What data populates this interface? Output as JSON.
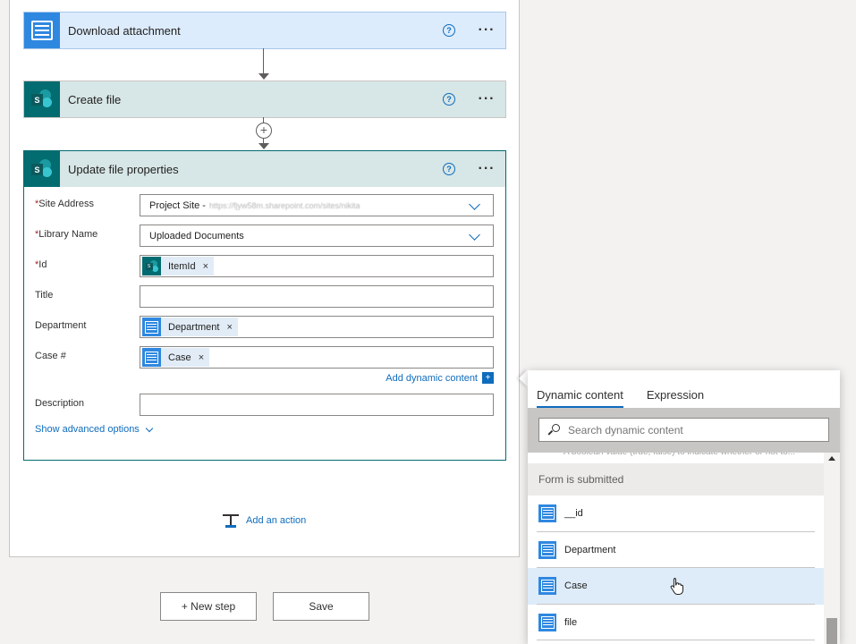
{
  "flow": {
    "steps": [
      {
        "title": "Download attachment"
      },
      {
        "title": "Create file"
      },
      {
        "title": "Update file properties"
      }
    ],
    "fields": {
      "site_address": {
        "label": "Site Address",
        "value": "Project Site - ",
        "url": "https://fjyw58m.sharepoint.com/sites/nikita"
      },
      "library_name": {
        "label": "Library Name",
        "value": "Uploaded Documents"
      },
      "id": {
        "label": "Id",
        "token": "ItemId"
      },
      "title": {
        "label": "Title"
      },
      "department": {
        "label": "Department",
        "token": "Department"
      },
      "case": {
        "label": "Case #",
        "token": "Case"
      },
      "description": {
        "label": "Description"
      }
    },
    "required_mark": "*",
    "token_remove": "×",
    "add_dynamic_content": "Add dynamic content",
    "add_dynamic_plus": "+",
    "show_advanced": "Show advanced options",
    "add_action": "Add an action",
    "new_step": "+ New step",
    "save": "Save",
    "more_glyph": "···",
    "help_glyph": "?"
  },
  "dynamic_panel": {
    "tabs": [
      "Dynamic content",
      "Expression"
    ],
    "search_placeholder": "Search dynamic content",
    "truncated_text": "A boolean value (true, false) to indicate whether or not to...",
    "section": "Form is submitted",
    "items": [
      "__id",
      "Department",
      "Case",
      "file"
    ]
  }
}
